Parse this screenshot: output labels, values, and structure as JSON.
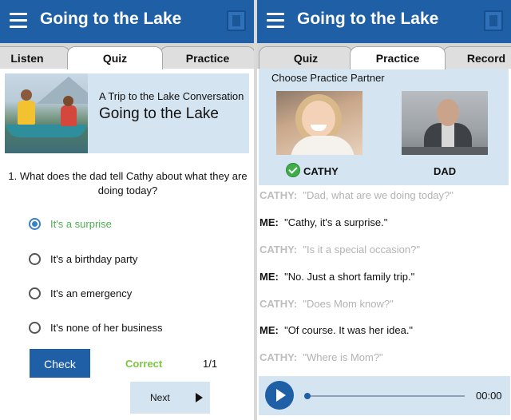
{
  "colors": {
    "appbar": "#1e5fa6",
    "card": "#d5e4f1",
    "correct": "#7cc63f",
    "selected_option": "#4caf50",
    "dim_text": "#b3b3b3"
  },
  "left": {
    "appbar": {
      "title": "Going to the Lake",
      "menu_icon": "hamburger-menu-icon",
      "book_icon": "book-icon"
    },
    "tabs": [
      {
        "label": "Listen"
      },
      {
        "label": "Quiz",
        "active": true
      },
      {
        "label": "Practice"
      }
    ],
    "header": {
      "subtitle": "A Trip to the Lake Conversation",
      "title": "Going to the Lake"
    },
    "question": "1. What does the dad tell Cathy about what they are doing today?",
    "options": [
      {
        "label": "It's a surprise",
        "selected": true
      },
      {
        "label": "It's a birthday party",
        "selected": false
      },
      {
        "label": "It's an emergency",
        "selected": false
      },
      {
        "label": "It's none of her business",
        "selected": false
      }
    ],
    "check_label": "Check",
    "result": "Correct",
    "progress": "1/1",
    "next_label": "Next"
  },
  "right": {
    "appbar": {
      "title": "Going to the Lake",
      "menu_icon": "hamburger-menu-icon",
      "book_icon": "book-icon"
    },
    "tabs": [
      {
        "label": "Quiz"
      },
      {
        "label": "Practice",
        "active": true
      },
      {
        "label": "Record"
      }
    ],
    "choose_label": "Choose Practice Partner",
    "partners": [
      {
        "name": "CATHY",
        "selected": true
      },
      {
        "name": "DAD",
        "selected": false
      }
    ],
    "dialog": [
      {
        "speaker": "CATHY:",
        "text": "\"Dad, what are we doing today?\"",
        "dim": true
      },
      {
        "speaker": "ME:",
        "text": "\"Cathy, it's a surprise.\"",
        "dim": false
      },
      {
        "speaker": "CATHY:",
        "text": "\"Is it a special occasion?\"",
        "dim": true
      },
      {
        "speaker": "ME:",
        "text": "\"No.  Just a short family trip.\"",
        "dim": false
      },
      {
        "speaker": "CATHY:",
        "text": "\"Does Mom know?\"",
        "dim": true
      },
      {
        "speaker": "ME:",
        "text": "\"Of course.  It was her idea.\"",
        "dim": false
      },
      {
        "speaker": "CATHY:",
        "text": "\"Where is Mom?\"",
        "dim": true
      }
    ],
    "player": {
      "time": "00:00",
      "progress": 0
    }
  }
}
